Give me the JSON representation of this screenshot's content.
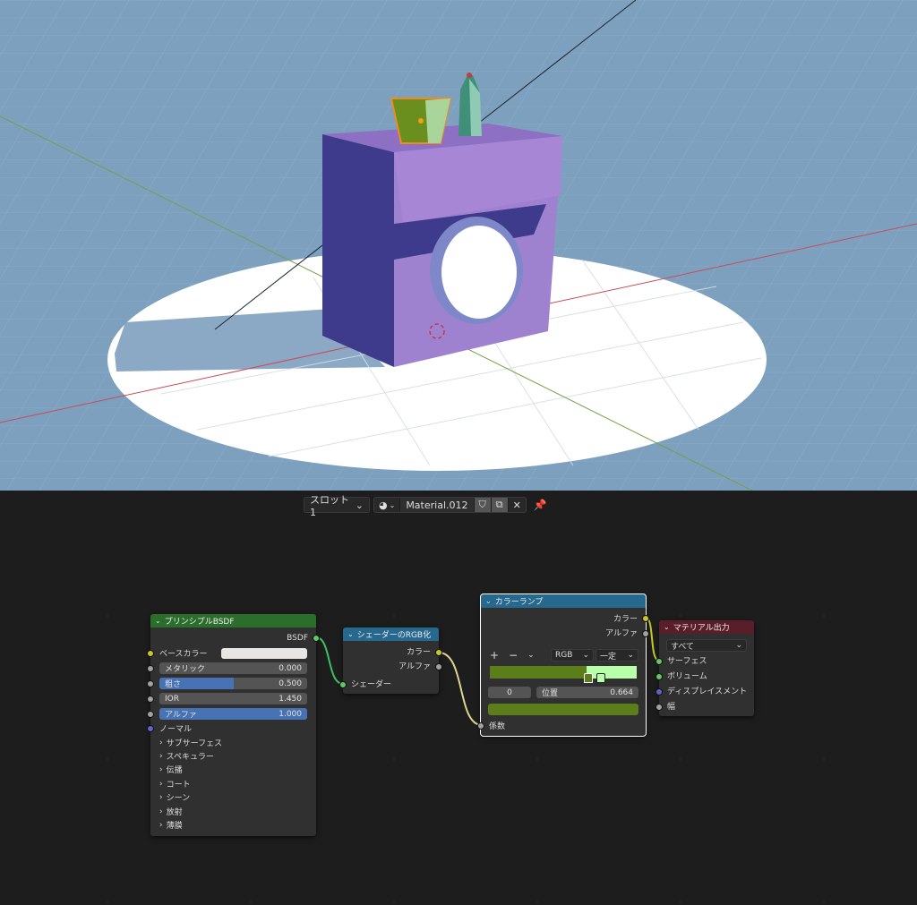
{
  "header": {
    "slot": "スロット1",
    "material_name": "Material.012"
  },
  "bsdf_node": {
    "title": "プリンシプルBSDF",
    "output_label": "BSDF",
    "base_color_label": "ベースカラー",
    "base_color": "#e8e6e2",
    "metallic": {
      "label": "メタリック",
      "value": "0.000",
      "fraction": 0
    },
    "roughness": {
      "label": "粗さ",
      "value": "0.500",
      "fraction": 0.5
    },
    "ior": {
      "label": "IOR",
      "value": "1.450",
      "fraction": 0
    },
    "alpha": {
      "label": "アルファ",
      "value": "1.000",
      "fraction": 1
    },
    "normal_label": "ノーマル",
    "panels": [
      "サブサーフェス",
      "スペキュラー",
      "伝播",
      "コート",
      "シーン",
      "放射",
      "薄膜"
    ]
  },
  "shader_rgb_node": {
    "title": "シェーダーのRGB化",
    "color_out": "カラー",
    "alpha_out": "アルファ",
    "shader_in": "シェーダー"
  },
  "color_ramp_node": {
    "title": "カラーランプ",
    "color_out": "カラー",
    "alpha_out": "アルファ",
    "color_mode": "RGB",
    "interpolation": "一定",
    "stop_index": "0",
    "position_label": "位置",
    "position_value": "0.664",
    "factor_in": "係数",
    "stop_color_1": "#5b7d1a",
    "stop_color_2": "#b8ffaa",
    "stop_positions": [
      0.664,
      0.75
    ]
  },
  "material_output_node": {
    "title": "マテリアル出力",
    "target": "すべて",
    "surface": "サーフェス",
    "volume": "ボリューム",
    "displacement": "ディスプレイスメント",
    "thickness": "幅"
  },
  "colors": {
    "viewport_bg": "#7ea0bf",
    "object_purple": "#9f82cf",
    "object_dark": "#3e3a8c",
    "bsdf_header": "#2b6d2b",
    "converter_header": "#27688f",
    "output_header": "#5a1e2b"
  }
}
